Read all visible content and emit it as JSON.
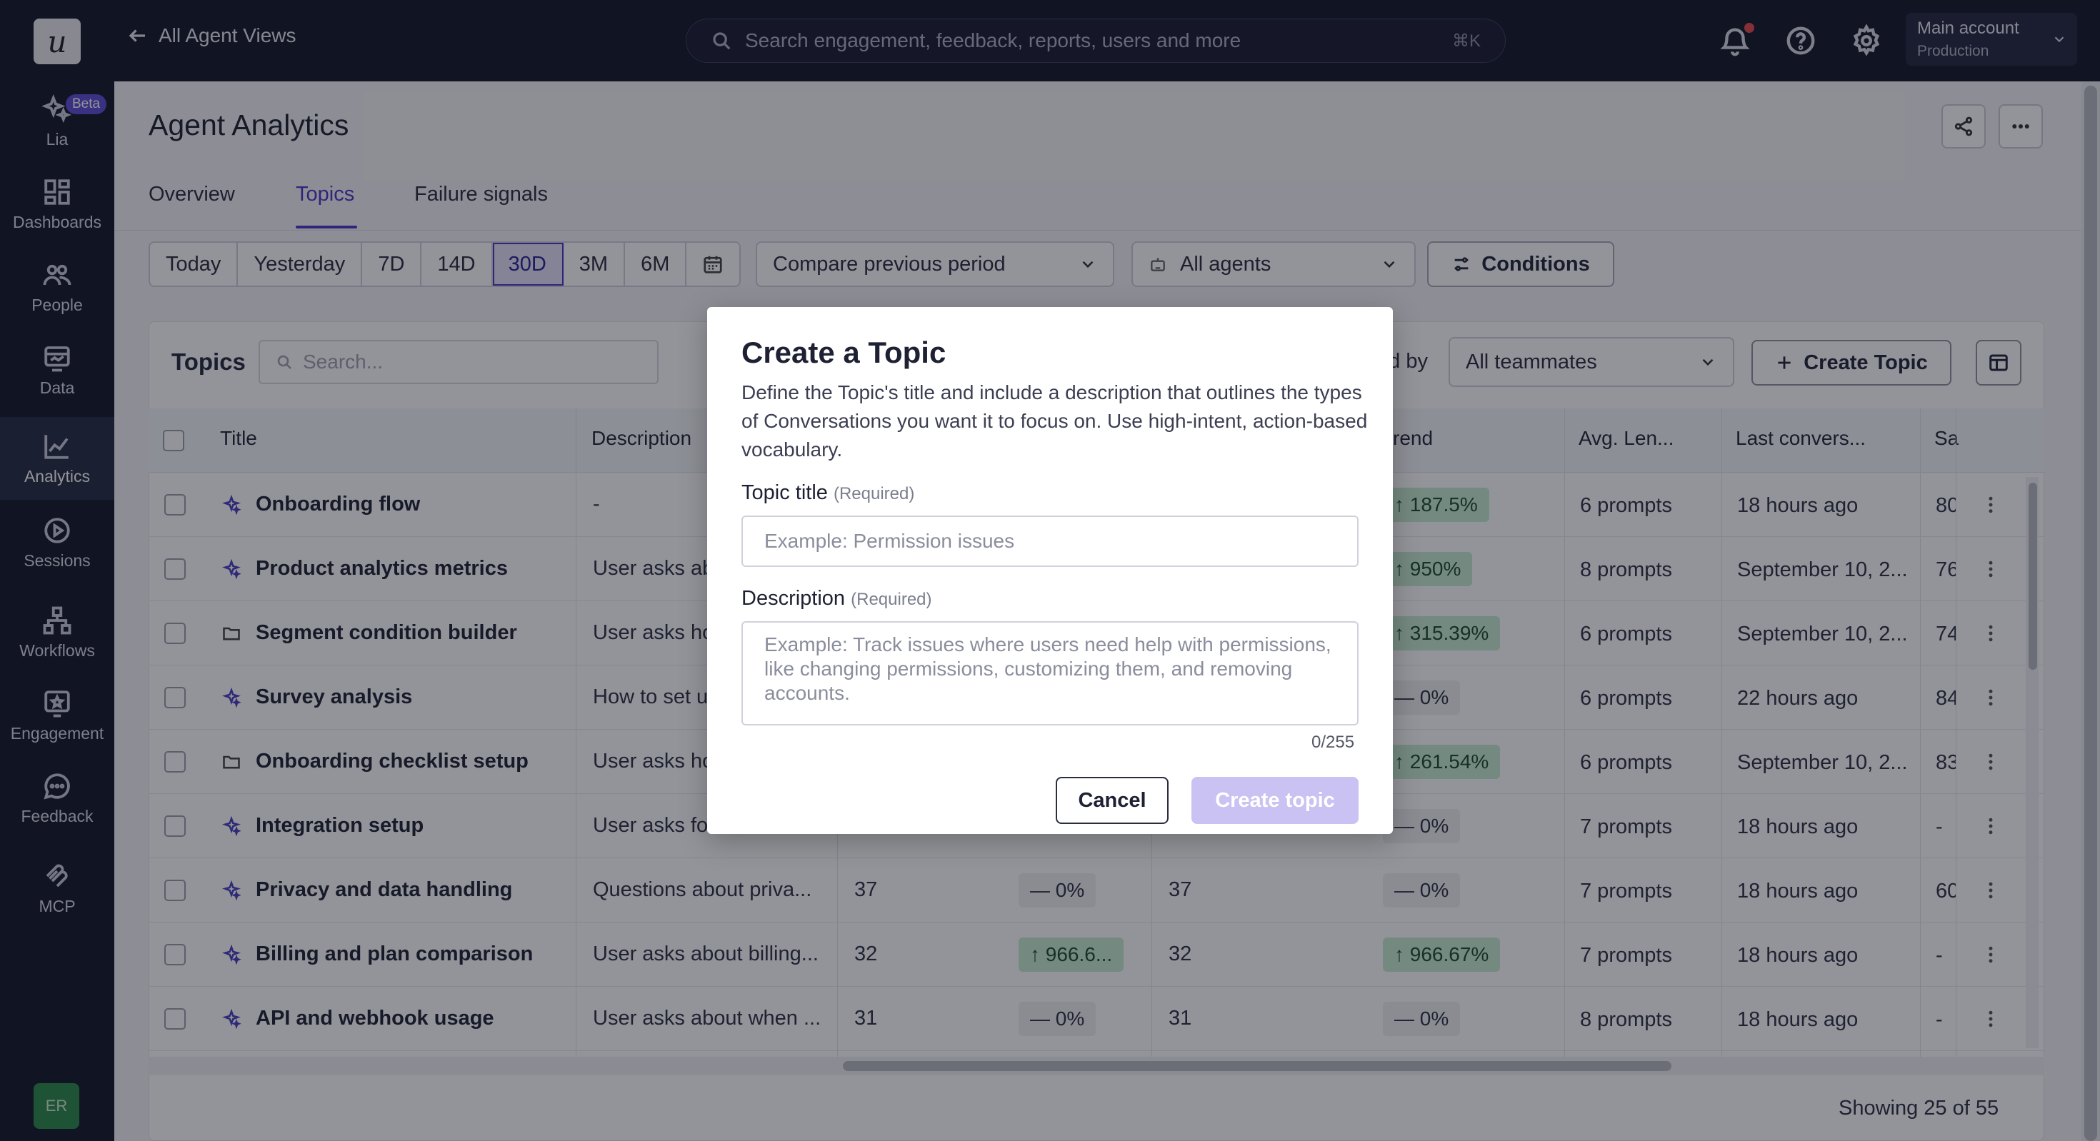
{
  "sidebar": {
    "logo": "u",
    "beta": "Beta",
    "items": [
      {
        "label": "Lia",
        "icon": "sparkles-icon"
      },
      {
        "label": "Dashboards",
        "icon": "dashboard-icon"
      },
      {
        "label": "People",
        "icon": "people-icon"
      },
      {
        "label": "Data",
        "icon": "data-icon"
      },
      {
        "label": "Analytics",
        "icon": "analytics-icon",
        "active": true
      },
      {
        "label": "Sessions",
        "icon": "play-icon"
      },
      {
        "label": "Workflows",
        "icon": "workflow-icon"
      },
      {
        "label": "Engagement",
        "icon": "engagement-icon"
      },
      {
        "label": "Feedback",
        "icon": "chat-icon"
      },
      {
        "label": "MCP",
        "icon": "mcp-icon"
      }
    ],
    "avatar": "ER"
  },
  "topbar": {
    "back_label": "All Agent Views",
    "search_placeholder": "Search engagement, feedback, reports, users and more",
    "search_shortcut": "⌘K",
    "account_name": "Main account",
    "account_env": "Production"
  },
  "page": {
    "title": "Agent Analytics",
    "tabs": [
      "Overview",
      "Topics",
      "Failure signals"
    ],
    "active_tab": "Topics",
    "date_ranges": [
      "Today",
      "Yesterday",
      "7D",
      "14D",
      "30D",
      "3M",
      "6M"
    ],
    "selected_range": "30D",
    "compare_select": "Compare previous period",
    "agents_select": "All agents",
    "conditions_label": "Conditions"
  },
  "topics_table": {
    "label": "Topics",
    "search_placeholder": "Search...",
    "filter_label_fragment": "ed by",
    "teammates_select": "All teammates",
    "create_label": "Create Topic",
    "columns": [
      "Title",
      "Description",
      "rend",
      "Avg. Len...",
      "Last convers...",
      "Sa"
    ],
    "rows": [
      {
        "title": "Onboarding flow",
        "icon": "sparkles-icon",
        "desc": "-",
        "c1": "",
        "p1": "",
        "c2": "",
        "trend": "↑ 187.5%",
        "trend_type": "up",
        "len": "6 prompts",
        "last": "18 hours ago",
        "sa": "80"
      },
      {
        "title": "Product analytics metrics",
        "icon": "sparkles-icon",
        "desc": "User asks ab",
        "c1": "",
        "p1": "",
        "c2": "",
        "trend": "↑ 950%",
        "trend_type": "up",
        "len": "8 prompts",
        "last": "September 10, 2...",
        "sa": "76"
      },
      {
        "title": "Segment condition builder",
        "icon": "folder-icon",
        "desc": "User asks ho",
        "c1": "",
        "p1": "",
        "c2": "",
        "trend": "↑ 315.39%",
        "trend_type": "up",
        "len": "6 prompts",
        "last": "September 10, 2...",
        "sa": "74"
      },
      {
        "title": "Survey analysis",
        "icon": "sparkles-icon",
        "desc": "How to set u",
        "c1": "",
        "p1": "",
        "c2": "",
        "trend": "— 0%",
        "trend_type": "flat",
        "len": "6 prompts",
        "last": "22 hours ago",
        "sa": "84"
      },
      {
        "title": "Onboarding checklist setup",
        "icon": "folder-icon",
        "desc": "User asks ho",
        "c1": "",
        "p1": "",
        "c2": "",
        "trend": "↑ 261.54%",
        "trend_type": "up",
        "len": "6 prompts",
        "last": "September 10, 2...",
        "sa": "83"
      },
      {
        "title": "Integration setup",
        "icon": "sparkles-icon",
        "desc": "User asks fo",
        "c1": "",
        "p1": "",
        "c2": "",
        "trend": "— 0%",
        "trend_type": "flat",
        "len": "7 prompts",
        "last": "18 hours ago",
        "sa": "-"
      },
      {
        "title": "Privacy and data handling",
        "icon": "sparkles-icon",
        "desc": "Questions about priva...",
        "c1": "37",
        "p1": "— 0%",
        "p1_type": "flat",
        "c2": "37",
        "trend": "— 0%",
        "trend_type": "flat",
        "len": "7 prompts",
        "last": "18 hours ago",
        "sa": "60"
      },
      {
        "title": "Billing and plan comparison",
        "icon": "sparkles-icon",
        "desc": "User asks about billing...",
        "c1": "32",
        "p1": "↑ 966.6...",
        "p1_type": "up",
        "c2": "32",
        "trend": "↑ 966.67%",
        "trend_type": "up",
        "len": "7 prompts",
        "last": "18 hours ago",
        "sa": "-"
      },
      {
        "title": "API and webhook usage",
        "icon": "sparkles-icon",
        "desc": "User asks about when ...",
        "c1": "31",
        "p1": "— 0%",
        "p1_type": "flat",
        "c2": "31",
        "trend": "— 0%",
        "trend_type": "flat",
        "len": "8 prompts",
        "last": "18 hours ago",
        "sa": "-"
      }
    ],
    "showing": "Showing 25 of 55"
  },
  "modal": {
    "title": "Create a Topic",
    "description": "Define the Topic's title and include a description that outlines the types of Conversations you want it to focus on. Use high-intent, action-based vocabulary.",
    "title_label": "Topic title",
    "title_req": "(Required)",
    "title_placeholder": "Example: Permission issues",
    "desc_label": "Description",
    "desc_req": "(Required)",
    "desc_placeholder": "Example: Track issues where users need help with permissions, like changing permissions, customizing them, and removing accounts.",
    "char_count": "0/255",
    "cancel_label": "Cancel",
    "create_label": "Create topic"
  },
  "colors": {
    "sidebar_bg": "#131629",
    "accent": "#4936c9",
    "trend_up_bg": "#c7ebd1",
    "create_disabled": "#c9c2f3"
  }
}
